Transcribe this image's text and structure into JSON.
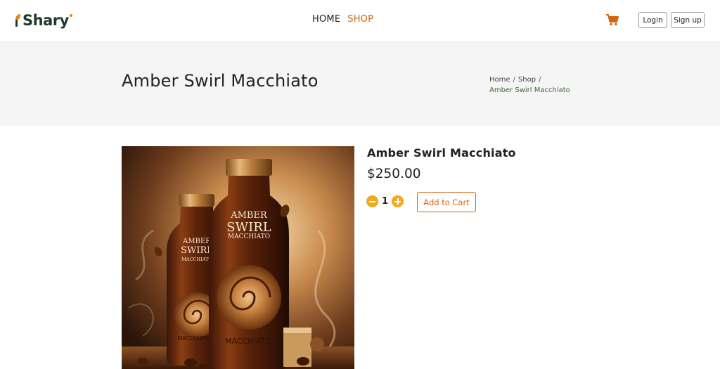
{
  "brand": {
    "name": "Shary"
  },
  "nav": {
    "home": "HOME",
    "shop": "SHOP"
  },
  "auth": {
    "login": "Login",
    "signup": "Sign up"
  },
  "hero": {
    "title": "Amber Swirl Macchiato",
    "breadcrumb": {
      "home": "Home",
      "shop": "Shop",
      "current": "Amber Swirl Macchiato",
      "separator": "/"
    }
  },
  "product": {
    "name": "Amber Swirl Macchiato",
    "price": "$250.00",
    "quantity": "1",
    "add_to_cart": "Add to Cart",
    "image": {
      "bottle_small": {
        "line1": "AMBER",
        "line2": "SWIRL",
        "line3": "MACCHIATO",
        "bottom": "MACCHIATO"
      },
      "bottle_large": {
        "line1": "AMBER",
        "line2": "SWIRL",
        "line3": "MACCHIATO",
        "bottom": "MACCHIATO"
      }
    }
  },
  "colors": {
    "accent": "#d4650f",
    "qty_button": "#f0a91e",
    "breadcrumb_current": "#3a6b2e",
    "hero_bg": "#f5f5f5"
  },
  "icons": {
    "cart": "shopping-cart-icon",
    "minus": "minus-circle-icon",
    "plus": "plus-circle-icon"
  }
}
